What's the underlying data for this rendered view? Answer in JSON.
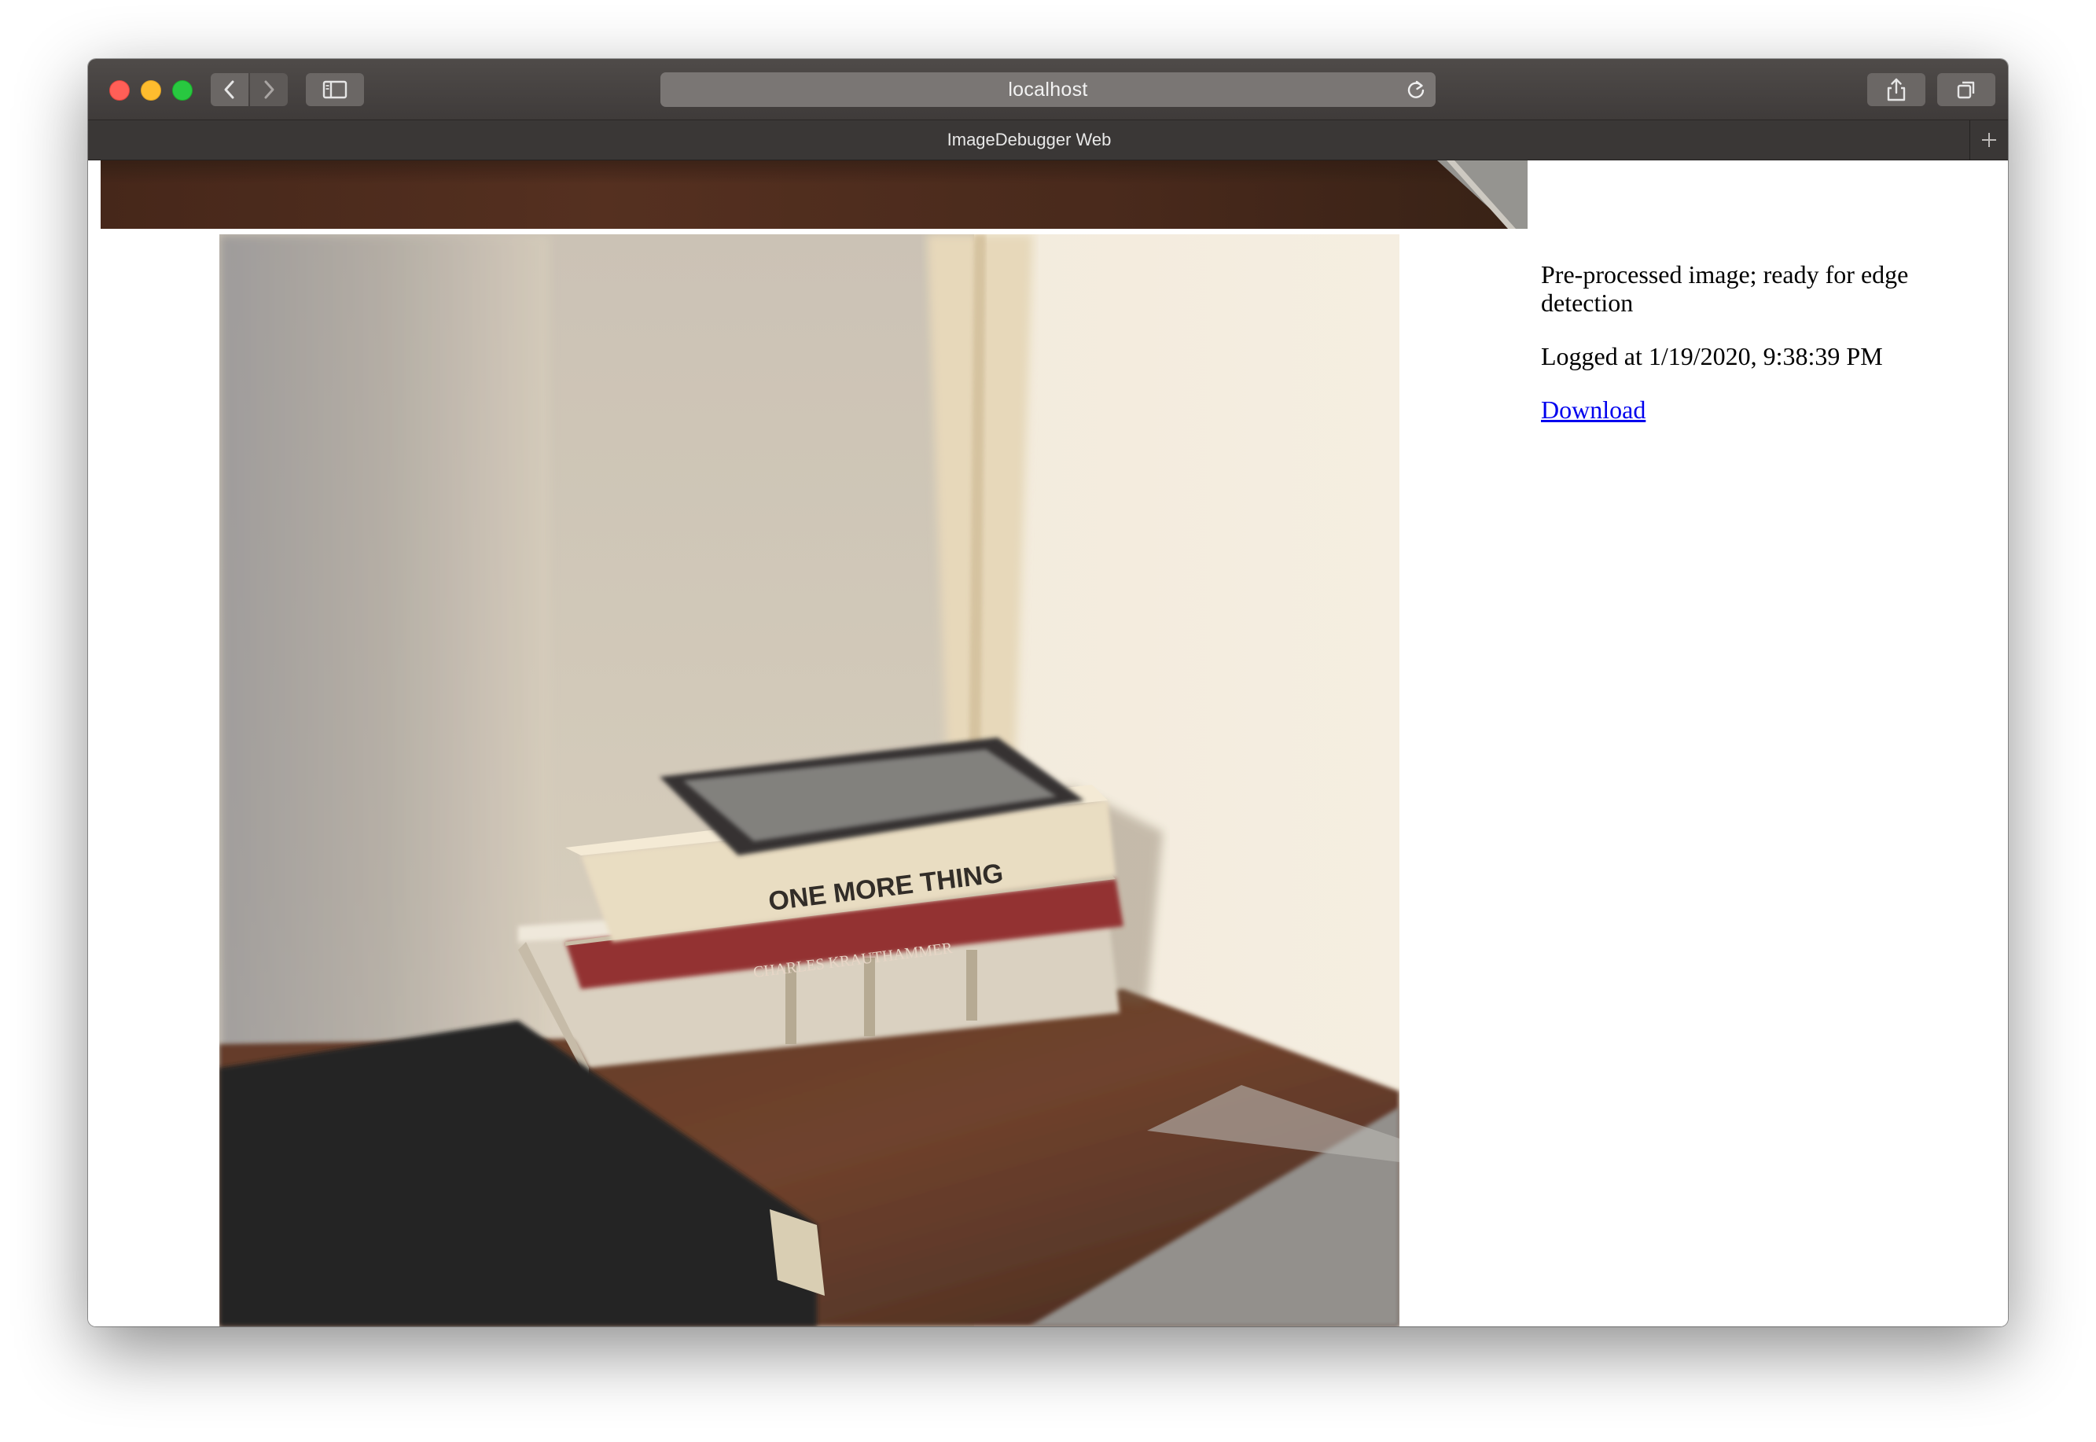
{
  "browser": {
    "url": "localhost",
    "tab_title": "ImageDebugger Web",
    "icons": [
      "back-icon",
      "forward-icon",
      "sidebar-icon",
      "reload-icon",
      "share-icon",
      "tabs-overview-icon",
      "new-tab-icon"
    ]
  },
  "entry": {
    "description": "Pre-processed image; ready for edge detection",
    "logged": "Logged at 1/19/2020, 9:38:39 PM",
    "download_label": "Download"
  },
  "colors": {
    "link": "#0000ee",
    "toolbar": "#4a4645",
    "close": "#ff5f57",
    "minimize": "#febc2e",
    "maximize": "#28c840"
  }
}
